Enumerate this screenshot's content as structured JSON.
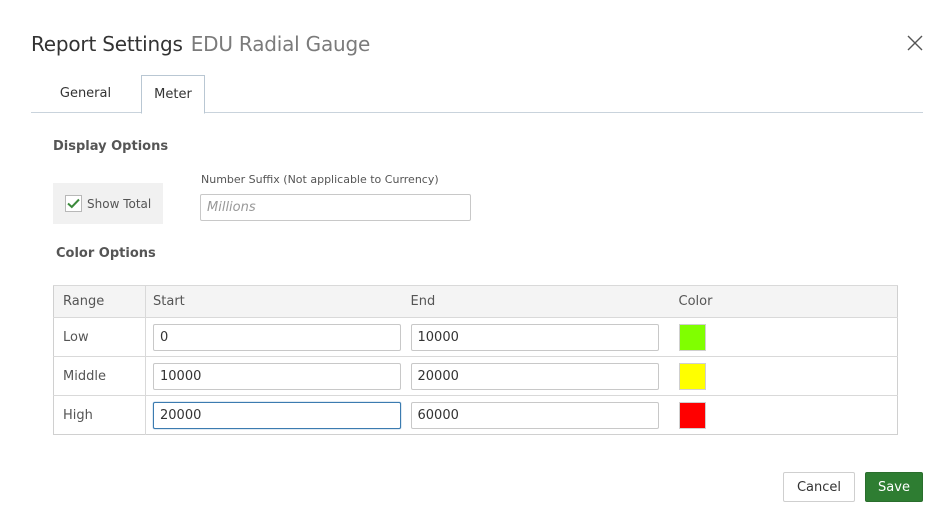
{
  "dialog": {
    "title": "Report Settings",
    "subtitle": "EDU Radial Gauge",
    "close_icon": "close-icon"
  },
  "tabs": [
    {
      "label": "General",
      "active": false
    },
    {
      "label": "Meter",
      "active": true
    }
  ],
  "display_options": {
    "heading": "Display Options",
    "show_total": {
      "label": "Show Total",
      "checked": true
    },
    "number_suffix": {
      "label": "Number Suffix (Not applicable to Currency)",
      "value": "",
      "placeholder": "Millions"
    }
  },
  "color_options": {
    "heading": "Color Options",
    "columns": [
      "Range",
      "Start",
      "End",
      "Color"
    ],
    "rows": [
      {
        "range": "Low",
        "start": "0",
        "end": "10000",
        "color": "#80ff00"
      },
      {
        "range": "Middle",
        "start": "10000",
        "end": "20000",
        "color": "#ffff00"
      },
      {
        "range": "High",
        "start": "20000",
        "end": "60000",
        "color": "#ff0000"
      }
    ]
  },
  "footer": {
    "cancel_label": "Cancel",
    "save_label": "Save"
  },
  "colors": {
    "accent": "#2e7d32",
    "focus": "#3b7bb0",
    "checkmark": "#3c8a3c"
  }
}
